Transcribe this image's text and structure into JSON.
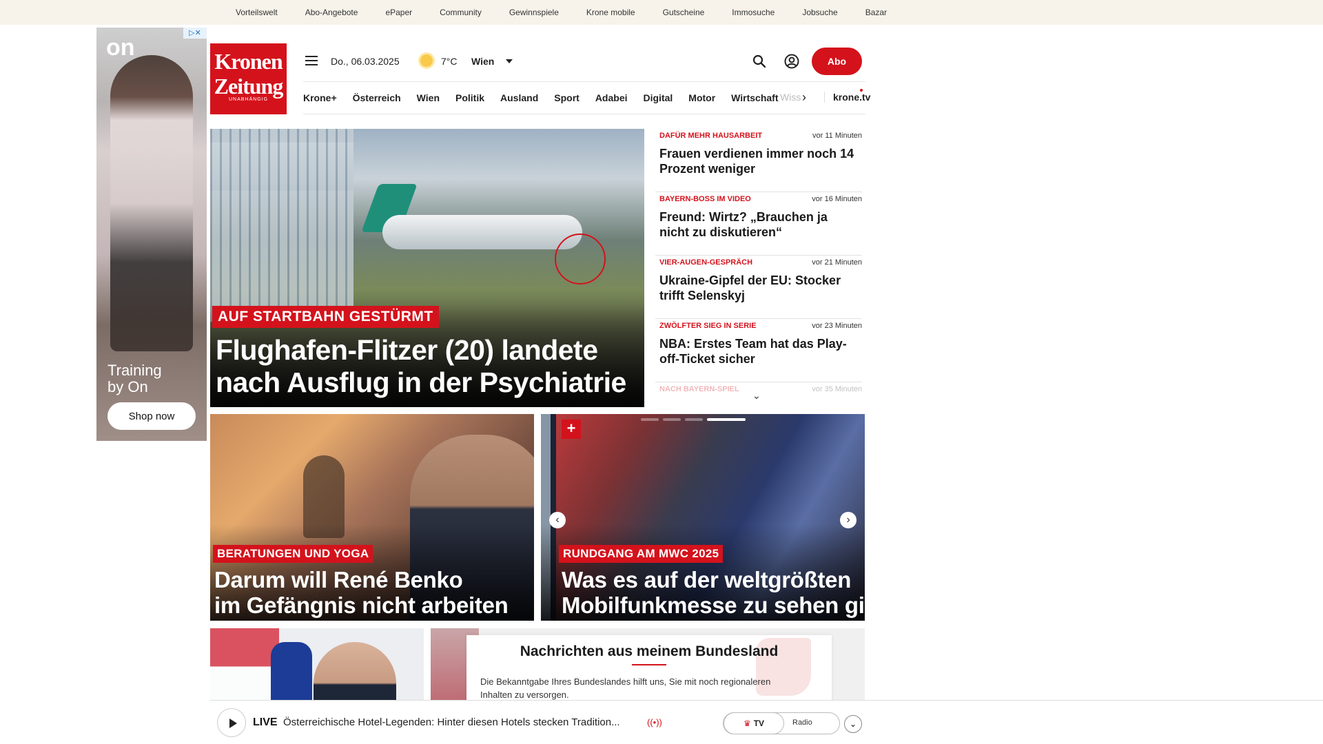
{
  "util_links": [
    "Vorteilswelt",
    "Abo-Angebote",
    "ePaper",
    "Community",
    "Gewinnspiele",
    "Krone mobile",
    "Gutscheine",
    "Immosuche",
    "Jobsuche",
    "Bazar"
  ],
  "ad": {
    "logo": "on",
    "choices": "▷✕",
    "tagline_1": "Training",
    "tagline_2": "by On",
    "cta": "Shop now"
  },
  "brand": {
    "line1": "Kronen",
    "line2": "Zeitung",
    "line3": "UNABHÄNGIG"
  },
  "header": {
    "date": "Do., 06.03.2025",
    "temp": "7°C",
    "city": "Wien",
    "abo": "Abo"
  },
  "nav": {
    "items": [
      "Krone+",
      "Österreich",
      "Wien",
      "Politik",
      "Ausland",
      "Sport",
      "Adabei",
      "Digital",
      "Motor",
      "Wirtschaft"
    ],
    "more": "Wiss",
    "chevron": "›",
    "tv": "krone.tv"
  },
  "hero": {
    "kicker": "AUF STARTBAHN GESTÜRMT",
    "title_1": "Flughafen-Flitzer (20) landete",
    "title_2": "nach Ausflug in der Psychiatrie"
  },
  "ticker": [
    {
      "kicker": "DAFÜR MEHR HAUSARBEIT",
      "time": "vor 11 Minuten",
      "headline": "Frauen verdienen immer noch 14 Prozent weniger"
    },
    {
      "kicker": "BAYERN-BOSS IM VIDEO",
      "time": "vor 16 Minuten",
      "headline": "Freund: Wirtz? „Brauchen ja nicht zu diskutieren“"
    },
    {
      "kicker": "VIER-AUGEN-GESPRÄCH",
      "time": "vor 21 Minuten",
      "headline": "Ukraine-Gipfel der EU: Stocker trifft Selenskyj"
    },
    {
      "kicker": "ZWÖLFTER SIEG IN SERIE",
      "time": "vor 23 Minuten",
      "headline": "NBA: Erstes Team hat das Play-off-Ticket sicher"
    },
    {
      "kicker": "NACH BAYERN-SPIEL",
      "time": "vor 35 Minuten",
      "headline": ""
    }
  ],
  "ticker_more": "⌄",
  "card1": {
    "kicker": "BERATUNGEN UND YOGA",
    "title_1": "Darum will René Benko",
    "title_2": "im Gefängnis nicht arbeiten"
  },
  "card2": {
    "kicker": "RUNDGANG AM MWC 2025",
    "title_1": "Was es auf der weltgrößten",
    "title_2": "Mobilfunkmesse zu sehen gibt",
    "plus": "+",
    "prev": "‹",
    "next": "›"
  },
  "bundesland": {
    "title": "Nachrichten aus meinem Bundesland",
    "text": "Die Bekanntgabe Ihres Bundeslandes hilft uns, Sie mit noch regionaleren Inhalten zu versorgen."
  },
  "live": {
    "label": "LIVE",
    "text": "Österreichische Hotel-Legenden: Hinter diesen Hotels stecken Tradition...",
    "radio_icon": "((•))",
    "tv": "TV",
    "radio": "Radio",
    "down": "⌄"
  }
}
